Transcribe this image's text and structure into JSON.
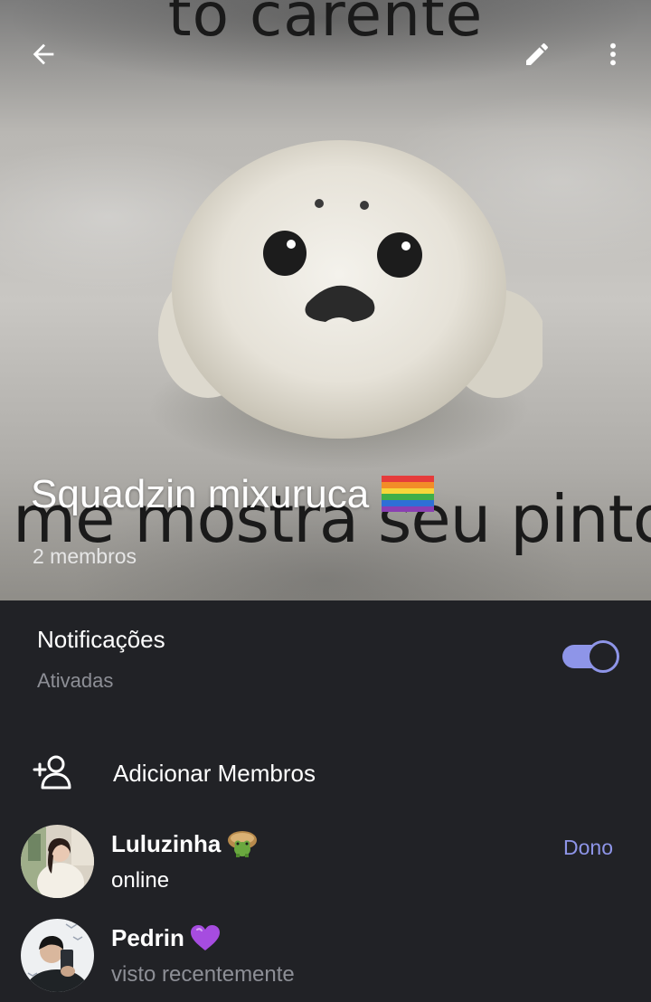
{
  "header": {
    "photo_caption_top": "to carente",
    "photo_caption_bottom": "me mostra seu pinto?",
    "title": "Squadzin mixuruca",
    "title_emoji": "rainbow-flag",
    "member_count": "2 membros",
    "icons": {
      "back": "arrow-left-icon",
      "edit": "pencil-icon",
      "more": "more-vertical-icon"
    }
  },
  "notifications": {
    "title": "Notificações",
    "status": "Ativadas",
    "enabled": true,
    "accent": "#8e95e8"
  },
  "add_members": {
    "label": "Adicionar Membros",
    "icon": "add-user-icon"
  },
  "members": [
    {
      "name": "Luluzinha",
      "emoji": "green-frog-cup-icon",
      "status": "online",
      "role": "Dono"
    },
    {
      "name": "Pedrin",
      "emoji": "purple-heart",
      "status": "visto recentemente",
      "role": ""
    }
  ],
  "colors": {
    "background": "#212226",
    "accent": "#8e95e8",
    "muted_text": "#8d8f96"
  }
}
